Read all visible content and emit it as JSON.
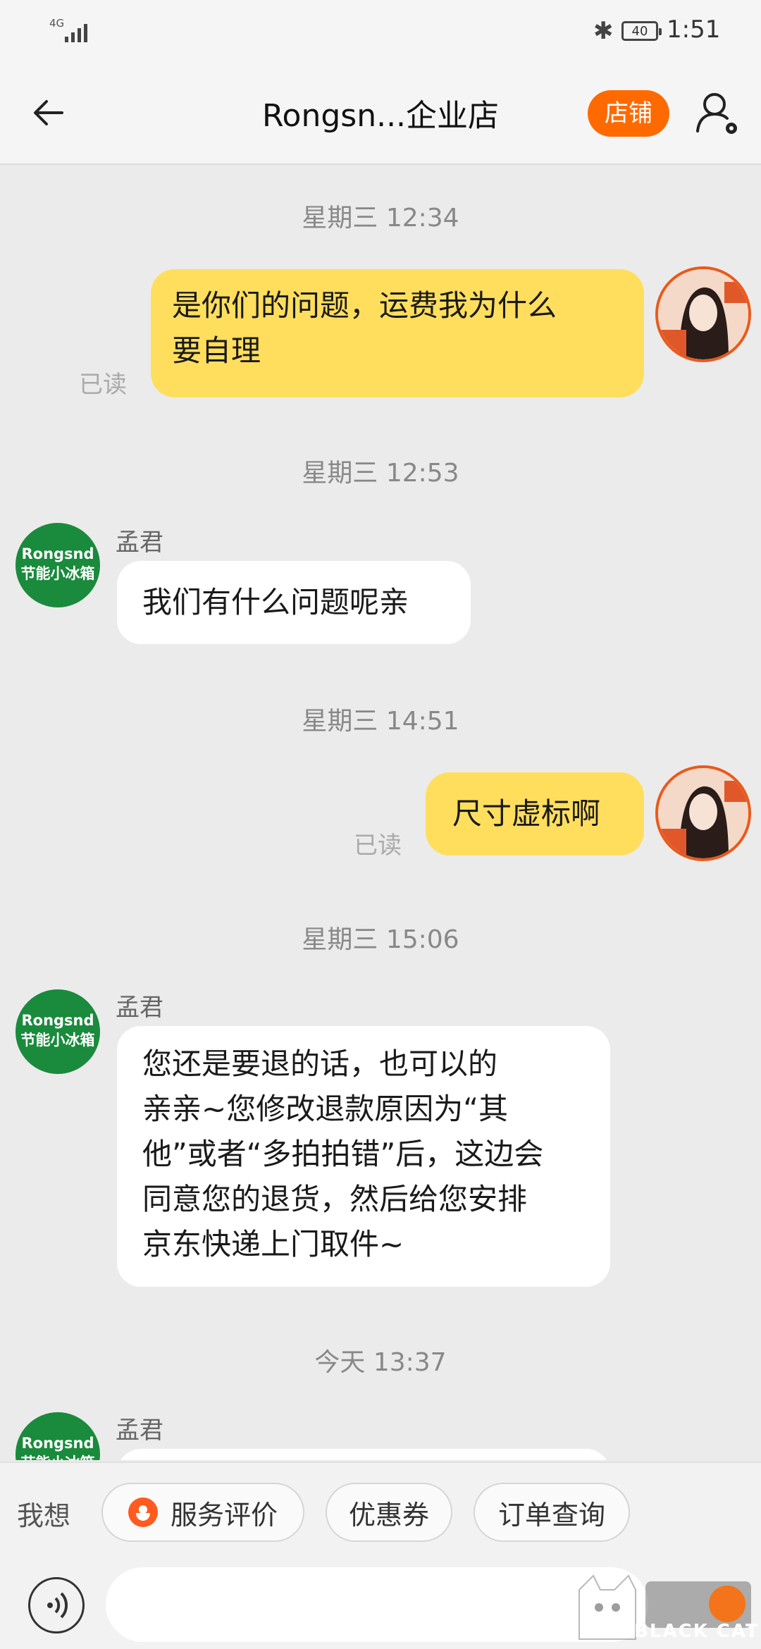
{
  "status_bar": {
    "network": "4G",
    "battery": "40",
    "time": "1:51"
  },
  "header": {
    "title": "Rongsn...企业店",
    "store_button": "店铺"
  },
  "messages": [
    {
      "type": "time",
      "text": "星期三 12:34"
    },
    {
      "type": "self",
      "text_lines": [
        "是你们的问题，运费我为什么",
        "要自理"
      ],
      "read": "已读"
    },
    {
      "type": "time",
      "text": "星期三 12:53"
    },
    {
      "type": "other",
      "sender": "孟君",
      "avatar_lines": [
        "Rongsnd",
        "节能小冰箱"
      ],
      "text": "我们有什么问题呢亲"
    },
    {
      "type": "time",
      "text": "星期三 14:51"
    },
    {
      "type": "self",
      "text": "尺寸虚标啊",
      "read": "已读"
    },
    {
      "type": "time",
      "text": "星期三 15:06"
    },
    {
      "type": "other",
      "sender": "孟君",
      "avatar_lines": [
        "Rongsnd",
        "节能小冰箱"
      ],
      "text_lines": [
        "您还是要退的话，也可以的",
        "亲亲~您修改退款原因为“其",
        "他”或者“多拍拍错”后，这边会",
        "同意您的退货，然后给您安排",
        "京东快递上门取件~"
      ]
    },
    {
      "type": "time",
      "text": "今天  13:37"
    },
    {
      "type": "other",
      "sender": "孟君",
      "avatar_lines": [
        "Rongsnd",
        "节能小冰箱"
      ],
      "text": ""
    }
  ],
  "quick_bar": {
    "label": "我想",
    "chips": [
      "服务评价",
      "优惠券",
      "订单查询"
    ]
  },
  "input": {
    "placeholder": ""
  },
  "watermark": {
    "text": "BLACK CAT"
  }
}
